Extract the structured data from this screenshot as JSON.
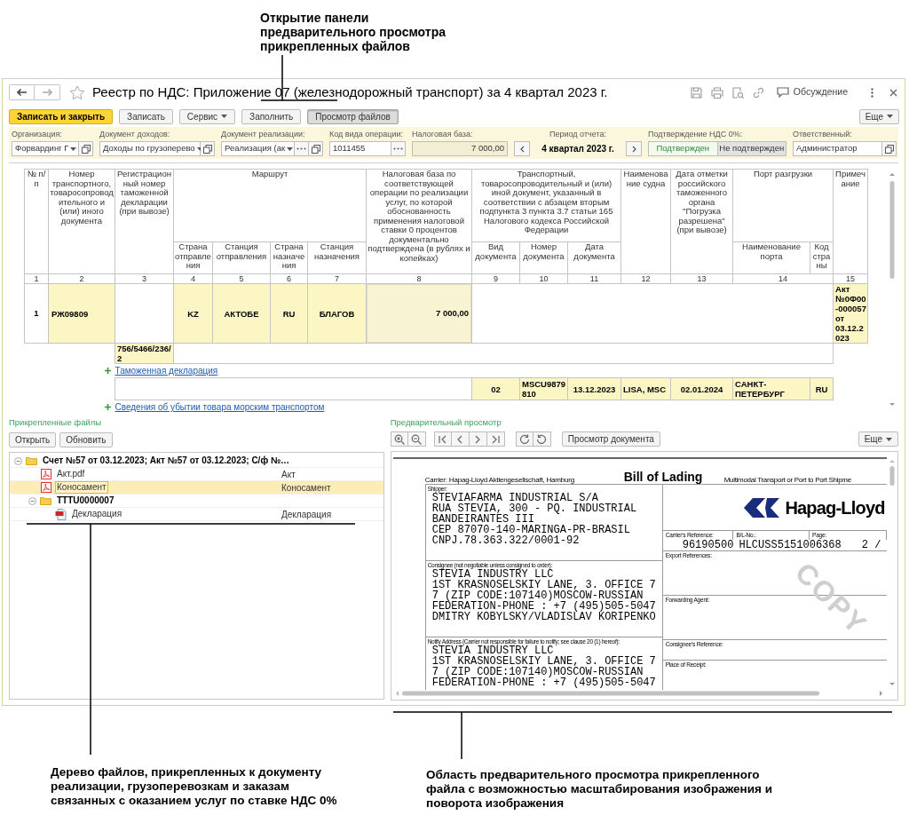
{
  "annotations": [
    {
      "kind": "top",
      "text": "Открытие панели предварительного просмотра прикрепленных файлов"
    },
    {
      "kind": "bottom_left",
      "text": "Дерево файлов, прикрепленных к документу реализации, грузоперевозкам и заказам связанных с оказанием услуг по ставке НДС 0%"
    },
    {
      "kind": "bottom_right",
      "text": "Область предварительного просмотра прикрепленного файла с возможностью масштабирования изображения и поворота изображения"
    }
  ],
  "window": {
    "title": "Реестр по НДС: Приложение 07 (железнодорожный транспорт) за 4 квартал 2023 г.",
    "discussion": "Обсуждение",
    "more": "Еще",
    "toolbar": [
      {
        "label": "Записать и закрыть",
        "kind": "primary"
      },
      {
        "label": "Записать",
        "kind": "plain"
      },
      {
        "label": "Сервис",
        "kind": "menu"
      },
      {
        "label": "Заполнить",
        "kind": "plain"
      },
      {
        "label": "Просмотр файлов",
        "kind": "pressed"
      }
    ]
  },
  "fields": [
    {
      "kind": "select",
      "label": "Организация:",
      "value": "Форвардинг Г"
    },
    {
      "kind": "select",
      "label": "Документ доходов:",
      "value": "Доходы по грузоперево"
    },
    {
      "kind": "select_choice",
      "label": "Документ реализации:",
      "value": "Реализация (ак"
    },
    {
      "kind": "choice",
      "label": "Код вида операции:",
      "value": "1011455"
    },
    {
      "kind": "readonly",
      "label": "Налоговая база:",
      "value": "7 000,00"
    },
    {
      "kind": "period",
      "label": "Период отчета:",
      "value": "4 квартал 2023 г."
    },
    {
      "kind": "toggle",
      "label": "Подтверждение НДС 0%:",
      "options": [
        {
          "label": "Подтвержден",
          "selected": true
        },
        {
          "label": "Не подтвержден",
          "selected": false
        }
      ]
    },
    {
      "kind": "open",
      "label": "Ответственный:",
      "value": "Администратор"
    }
  ],
  "table": {
    "header": [
      {
        "heading": "№ п/п",
        "number": "1"
      },
      {
        "heading": "Номер транспортного, товаросопроводительного и (или) иного документа",
        "number": "2"
      },
      {
        "heading": "Регистрационный номер таможенной декларации (при вывозе)",
        "number": "3"
      },
      {
        "heading": "Маршрут",
        "columns": [
          {
            "heading": "Страна отправления",
            "number": "4"
          },
          {
            "heading": "Станция отправления",
            "number": "5"
          },
          {
            "heading": "Страна назначения",
            "number": "6"
          },
          {
            "heading": "Станция назначения",
            "number": "7"
          }
        ]
      },
      {
        "heading": "Налоговая база по соответствующей операции по реализации услуг, по которой обоснованность применения налоговой ставки 0 процентов документально подтверждена (в рублях и копейках)",
        "number": "8"
      },
      {
        "heading": "Транспортный, товаросопроводительный и (или) иной документ, указанный в соответствии с абзацем вторым подпункта 3 пункта 3.7 статьи 165 Налогового кодекса Российской Федерации",
        "columns": [
          {
            "heading": "Вид документа",
            "number": "9"
          },
          {
            "heading": "Номер документа",
            "number": "10"
          },
          {
            "heading": "Дата документа",
            "number": "11"
          }
        ]
      },
      {
        "heading": "Наименование судна",
        "number": "12"
      },
      {
        "heading": "Дата отметки российского таможенного органа \"Погрузка разрешена\" (при вывозе)",
        "number": "13"
      },
      {
        "heading": "Порт разгрузки",
        "number": "14",
        "columns": [
          {
            "heading": "Наименование порта"
          },
          {
            "heading": "Код страны"
          }
        ]
      },
      {
        "heading": "Примечание",
        "number": "15"
      }
    ],
    "rows": [
      {
        "number": "1",
        "document": "РЖ09809",
        "route": [
          "KZ",
          "АКТОБЕ",
          "RU",
          "БЛАГОВ"
        ],
        "tax_base": "7 000,00",
        "note": "Акт №0Ф00-000057 от 03.12.2023",
        "customs_declarations": [
          "756/5466/236/2"
        ],
        "customs_link": "Таможенная декларация",
        "transport_documents": [
          {
            "type": "02",
            "number": "MSCU9879810",
            "date": "13.12.2023",
            "vessel": "LISA, MSC",
            "loading_date": "02.01.2024",
            "port": "САНКТ-ПЕТЕРБУРГ",
            "country": "RU"
          }
        ],
        "export_link": "Сведения об убытии товара морским транспортом"
      }
    ]
  },
  "files": {
    "label": "Прикрепленные файлы",
    "buttons": [
      "Открыть",
      "Обновить"
    ],
    "tree": [
      {
        "kind": "folder",
        "name": "Счет №57 от 03.12.2023; Акт №57 от 03.12.2023; С/ф №…",
        "expanded": true,
        "selected": false,
        "children": [
          {
            "kind": "pdf",
            "name": "Акт.pdf",
            "description": "Акт",
            "selected": false
          },
          {
            "kind": "pdf",
            "name": "Коносамент",
            "description": "Коносамент",
            "selected": true
          },
          {
            "kind": "folder",
            "name": "TTTU0000007",
            "expanded": true,
            "selected": false,
            "children": [
              {
                "kind": "png",
                "name": "Декларация",
                "description": "Декларация",
                "selected": false
              }
            ]
          }
        ]
      }
    ]
  },
  "preview": {
    "label": "Предварительный просмотр",
    "document_button": "Просмотр документа",
    "more": "Еще",
    "document": {
      "carrier": "Carrier: Hapag-Lloyd Aktiengesellschaft, Hamburg",
      "title": "Bill of Lading",
      "transport": "Multimodal Transport or Port to Port Shipme",
      "logo": "Hapag-Lloyd",
      "stamp": "COPY",
      "parties": [
        {
          "label": "Shipper:",
          "lines": [
            "STEVIAFARMA INDUSTRIAL S/A",
            "RUA STEVIA, 300 - PQ. INDUSTRIAL",
            "BANDEIRANTES III",
            "CEP 87070-140-MARINGA-PR-BRASIL",
            "CNPJ.78.363.322/0001-92"
          ]
        },
        {
          "label": "Consignee (not negotiable unless consigned to order):",
          "lines": [
            "STEVIA INDUSTRY LLC",
            "1ST KRASNOSELSKIY LANE, 3. OFFICE 7",
            "7 (ZIP CODE:107140)MOSCOW-RUSSIAN",
            "FEDERATION-PHONE : +7 (495)505-5047",
            "DMITRY KOBYLSKY/VLADISLAV KORIPENKO"
          ]
        },
        {
          "label": "Notify Address (Carrier not responsible for failure to notify; see clause 20 (1) hereof):",
          "lines": [
            "STEVIA INDUSTRY LLC",
            "1ST KRASNOSELSKIY LANE, 3. OFFICE 7",
            "7 (ZIP CODE:107140)MOSCOW-RUSSIAN",
            "FEDERATION-PHONE : +7 (495)505-5047"
          ]
        }
      ],
      "references": [
        {
          "label": "Carrier's Reference:",
          "value": "96190500"
        },
        {
          "label": "B/L-No.:",
          "value": "HLCUSS5151006368"
        },
        {
          "label": "Page:",
          "value": "2 /"
        }
      ],
      "boxes": [
        "Export References:",
        "Forwarding Agent:",
        "Consignee's Reference:",
        "Place of Receipt:"
      ]
    }
  }
}
